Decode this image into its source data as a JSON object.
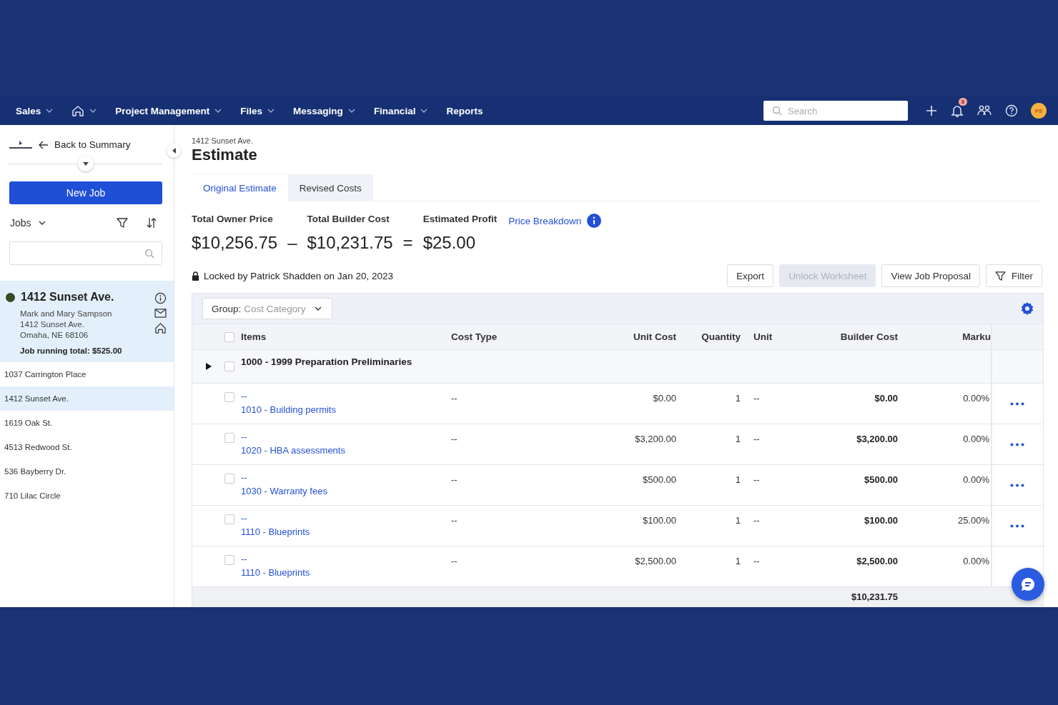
{
  "nav": {
    "items": [
      {
        "kind": "menu",
        "label": "Sales"
      },
      {
        "kind": "home"
      },
      {
        "kind": "menu",
        "label": "Project Management"
      },
      {
        "kind": "menu",
        "label": "Files"
      },
      {
        "kind": "menu",
        "label": "Messaging"
      },
      {
        "kind": "menu",
        "label": "Financial"
      },
      {
        "kind": "link",
        "label": "Reports"
      }
    ],
    "search": {
      "placeholder": "Search"
    },
    "notification_count": "3",
    "avatar": "PS"
  },
  "sidebar": {
    "back": "Back to Summary",
    "new_job": "New Job",
    "jobs_label": "Jobs",
    "current_job": {
      "title": "1412 Sunset Ave.",
      "lines": [
        "Mark and Mary Sampson",
        "1412 Sunset Ave.",
        "Omaha, NE 68106"
      ],
      "total": "Job running total: $525.00"
    },
    "jobs": [
      {
        "name": "1037 Carrington Place",
        "selected": false
      },
      {
        "name": "1412 Sunset Ave.",
        "selected": true
      },
      {
        "name": "1619 Oak St.",
        "selected": false
      },
      {
        "name": "4513 Redwood St.",
        "selected": false
      },
      {
        "name": "536 Bayberry Dr.",
        "selected": false
      },
      {
        "name": "710 Lilac Circle",
        "selected": false
      }
    ]
  },
  "page": {
    "breadcrumb": "1412 Sunset Ave.",
    "title": "Estimate",
    "tabs": [
      {
        "label": "Original Estimate",
        "selected": true
      },
      {
        "label": "Revised Costs",
        "selected": false
      }
    ],
    "summary": {
      "terms": [
        {
          "label": "Total Owner Price",
          "value": "$10,256.75"
        },
        {
          "label": "Total Builder Cost",
          "value": "$10,231.75"
        },
        {
          "label": "Estimated Profit",
          "value": "$25.00"
        }
      ],
      "operators": [
        "–",
        "="
      ],
      "link": "Price Breakdown"
    },
    "lock_note": "Locked by Patrick Shadden on Jan 20, 2023",
    "buttons": [
      {
        "kind": "plain",
        "label": "Export",
        "disabled": false
      },
      {
        "kind": "plain",
        "label": "Unlock Worksheet",
        "disabled": true
      },
      {
        "kind": "plain",
        "label": "View Job Proposal",
        "disabled": false
      },
      {
        "kind": "filter",
        "label": "Filter",
        "disabled": false
      }
    ],
    "group": {
      "label": "Group:",
      "value": "Cost Category"
    },
    "table": {
      "select_all_checked": false,
      "columns": [
        "Items",
        "Cost Type",
        "Unit Cost",
        "Quantity",
        "Unit",
        "Builder Cost",
        "Marku"
      ],
      "group_row": {
        "label": "1000 - 1999 Preparation Preliminaries",
        "expanded": false,
        "checked": false
      },
      "rows": [
        {
          "title": "--",
          "name": "1010 - Building permits",
          "cost_type": "--",
          "unit_cost": "$0.00",
          "quantity": "1",
          "unit": "--",
          "builder_cost": "$0.00",
          "markup": "0.00%",
          "checked": false
        },
        {
          "title": "--",
          "name": "1020 - HBA assessments",
          "cost_type": "--",
          "unit_cost": "$3,200.00",
          "quantity": "1",
          "unit": "--",
          "builder_cost": "$3,200.00",
          "markup": "0.00%",
          "checked": false
        },
        {
          "title": "--",
          "name": "1030 - Warranty fees",
          "cost_type": "--",
          "unit_cost": "$500.00",
          "quantity": "1",
          "unit": "--",
          "builder_cost": "$500.00",
          "markup": "0.00%",
          "checked": false
        },
        {
          "title": "--",
          "name": "1110 - Blueprints",
          "cost_type": "--",
          "unit_cost": "$100.00",
          "quantity": "1",
          "unit": "--",
          "builder_cost": "$100.00",
          "markup": "25.00%",
          "checked": false
        },
        {
          "title": "--",
          "name": "1110 - Blueprints",
          "cost_type": "--",
          "unit_cost": "$2,500.00",
          "quantity": "1",
          "unit": "--",
          "builder_cost": "$2,500.00",
          "markup": "0.00%",
          "checked": false
        }
      ],
      "footer_total": "$10,231.75"
    }
  }
}
